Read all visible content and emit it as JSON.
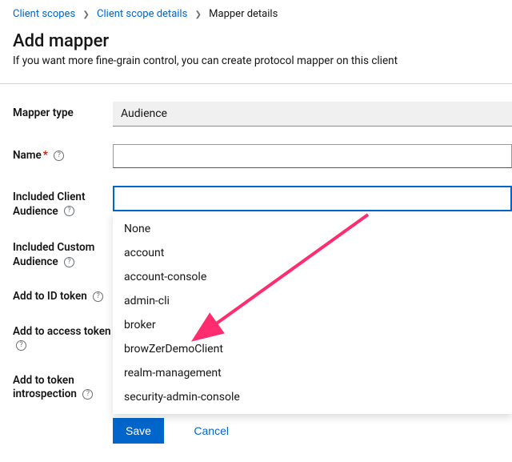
{
  "breadcrumb": {
    "a": "Client scopes",
    "b": "Client scope details",
    "c": "Mapper details"
  },
  "header": {
    "title": "Add mapper",
    "subtitle": "If you want more fine-grain control, you can create protocol mapper on this client"
  },
  "fields": {
    "mapper_type": {
      "label": "Mapper type",
      "value": "Audience"
    },
    "name": {
      "label": "Name",
      "value": ""
    },
    "incl_client_aud": {
      "label": "Included Client Audience",
      "value": ""
    },
    "incl_custom_aud": {
      "label": "Included Custom Audience"
    },
    "add_id_token": {
      "label": "Add to ID token"
    },
    "add_access_token": {
      "label": "Add to access token"
    },
    "add_introspection": {
      "label": "Add to token introspection"
    }
  },
  "dropdown": {
    "opt0": "None",
    "opt1": "account",
    "opt2": "account-console",
    "opt3": "admin-cli",
    "opt4": "broker",
    "opt5": "browZerDemoClient",
    "opt6": "realm-management",
    "opt7": "security-admin-console"
  },
  "actions": {
    "save": "Save",
    "cancel": "Cancel"
  }
}
